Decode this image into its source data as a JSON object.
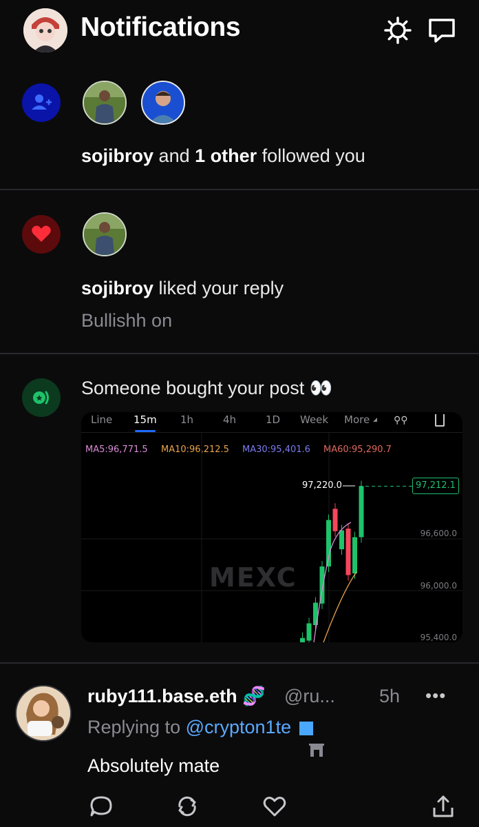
{
  "header": {
    "title": "Notifications",
    "settings_icon": "gear-icon",
    "messages_icon": "message-bubble-icon"
  },
  "notifications": [
    {
      "type": "follow",
      "icon": "add-user-icon",
      "icon_color": "#0a14a8",
      "actor": "sojibroy",
      "connector": "and",
      "others": "1 other",
      "action": "followed you"
    },
    {
      "type": "like",
      "icon": "heart-icon",
      "icon_color": "#5c0a0c",
      "actor": "sojibroy",
      "action": "liked your reply",
      "preview": "Bullishh on"
    },
    {
      "type": "purchase",
      "icon": "coin-icon",
      "icon_color": "#0b3a1f",
      "text": "Someone bought your post 👀"
    }
  ],
  "chart_card": {
    "tabs": [
      "Line",
      "15m",
      "1h",
      "4h",
      "1D",
      "Week",
      "More"
    ],
    "active_tab": "15m",
    "ma": [
      {
        "label": "MA5:96,771.5",
        "color": "#d98bd6"
      },
      {
        "label": "MA10:96,212.5",
        "color": "#e8a34d"
      },
      {
        "label": "MA30:95,401.6",
        "color": "#7c7cf0"
      },
      {
        "label": "MA60:95,290.7",
        "color": "#e06a5f"
      }
    ],
    "high_label": "97,220.0",
    "current_price": "97,212.1",
    "y_labels": [
      "96,600.0",
      "96,000.0",
      "95,400.0"
    ],
    "watermark": "MEXC"
  },
  "chart_data": {
    "type": "candlestick",
    "title": "",
    "interval": "15m",
    "ylim": [
      95400,
      97400
    ],
    "candles": [
      {
        "open": 95400,
        "close": 95450,
        "dir": "up"
      },
      {
        "open": 95420,
        "close": 95620,
        "dir": "up"
      },
      {
        "open": 95600,
        "close": 95860,
        "dir": "up"
      },
      {
        "open": 95850,
        "close": 96280,
        "dir": "up"
      },
      {
        "open": 96280,
        "close": 96820,
        "dir": "up"
      },
      {
        "open": 96950,
        "close": 96690,
        "dir": "down"
      },
      {
        "open": 96700,
        "close": 96480,
        "dir": "up"
      },
      {
        "open": 96720,
        "close": 96180,
        "dir": "down"
      },
      {
        "open": 96200,
        "close": 96620,
        "dir": "up"
      },
      {
        "open": 96620,
        "close": 97212.1,
        "dir": "up"
      }
    ]
  },
  "reply": {
    "name": "ruby111.base.eth 🧬",
    "handle": "@ru...",
    "time": "5h",
    "more": "•••",
    "replying_prefix": "Replying to",
    "replying_to": "@crypton1te",
    "text": "Absolutely mate",
    "actions": [
      "reply-icon",
      "repost-icon",
      "like-icon",
      "share-icon"
    ]
  }
}
